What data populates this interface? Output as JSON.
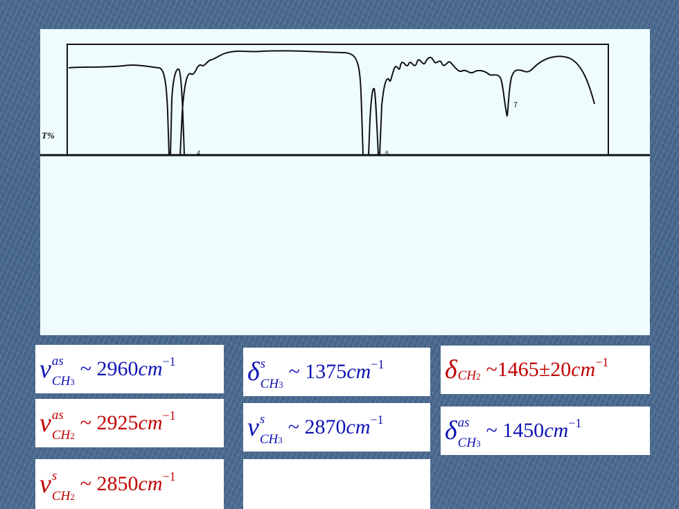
{
  "spectrum": {
    "y_axis_label": "T%",
    "peak_labels": [
      "4",
      "6",
      "7"
    ]
  },
  "formulas": [
    {
      "id": "f1",
      "color": "#0f13b5",
      "symbol": "ν",
      "sup": "as",
      "sub": "CH",
      "sub_index": "3",
      "value": "~ 2960",
      "unit": "cm",
      "exp": "−1"
    },
    {
      "id": "f2",
      "color": "#0f13b5",
      "symbol": "δ",
      "sup": "s",
      "sub": "CH",
      "sub_index": "3",
      "value": "~ 1375",
      "unit": "cm",
      "exp": "−1"
    },
    {
      "id": "f3",
      "color": "#c00000",
      "symbol": "δ",
      "sup": "",
      "sub": "CH",
      "sub_index": "2",
      "value": "~1465±20",
      "unit": "cm",
      "exp": "−1"
    },
    {
      "id": "f4",
      "color": "#c00000",
      "symbol": "ν",
      "sup": "as",
      "sub": "CH",
      "sub_index": "2",
      "value": "~ 2925",
      "unit": "cm",
      "exp": "−1"
    },
    {
      "id": "f5",
      "color": "#0f13b5",
      "symbol": "ν",
      "sup": "s",
      "sub": "CH",
      "sub_index": "3",
      "value": "~ 2870",
      "unit": "cm",
      "exp": "−1"
    },
    {
      "id": "f6",
      "color": "#0f13b5",
      "symbol": "δ",
      "sup": "as",
      "sub": "CH",
      "sub_index": "3",
      "value": "~ 1450",
      "unit": "cm",
      "exp": "−1"
    },
    {
      "id": "f7",
      "color": "#c00000",
      "symbol": "ν",
      "sup": "s",
      "sub": "CH",
      "sub_index": "2",
      "value": "~ 2850",
      "unit": "cm",
      "exp": "−1"
    }
  ]
}
